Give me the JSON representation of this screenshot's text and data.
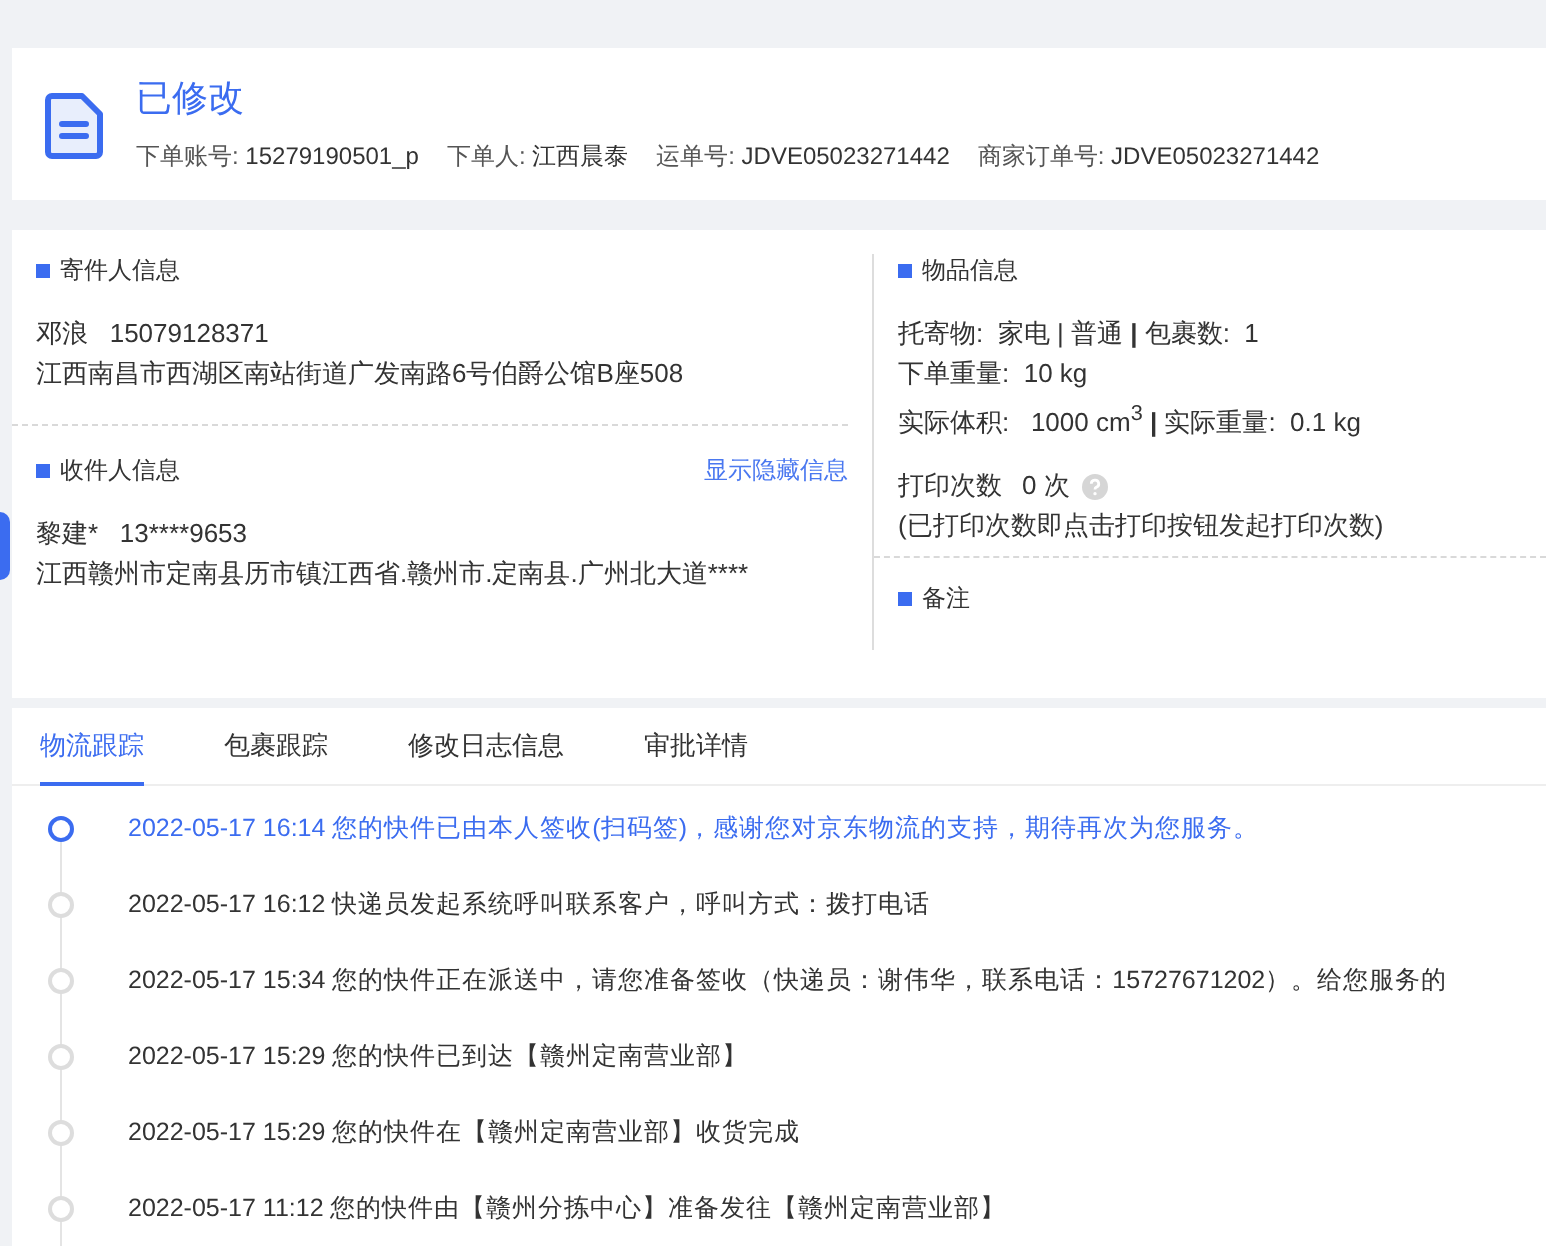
{
  "header": {
    "status": "已修改",
    "fields": [
      {
        "label": "下单账号:",
        "value": "15279190501_p"
      },
      {
        "label": "下单人:",
        "value": "江西晨泰"
      },
      {
        "label": "运单号:",
        "value": "JDVE05023271442"
      },
      {
        "label": "商家订单号:",
        "value": "JDVE05023271442"
      }
    ]
  },
  "sender": {
    "title": "寄件人信息",
    "name": "邓浪",
    "phone": "15079128371",
    "address": "江西南昌市西湖区南站街道广发南路6号伯爵公馆B座508"
  },
  "receiver": {
    "title": "收件人信息",
    "link": "显示隐藏信息",
    "name": "黎建*",
    "phone": "13****9653",
    "address": "江西赣州市定南县历市镇江西省.赣州市.定南县.广州北大道****"
  },
  "goods": {
    "title": "物品信息",
    "lines": [
      "托寄物:  家电 | 普通 **|** 包裹数:  1",
      "下单重量:  10 kg",
      "实际体积:   1000 cm$^{3}$ **|** 实际重量:  0.1 kg"
    ],
    "print_label": "打印次数",
    "print_value": "0 次",
    "print_note": "(已打印次数即点击打印按钮发起打印次数)"
  },
  "remarks": {
    "title": "备注"
  },
  "tabs": [
    {
      "label": "物流跟踪",
      "selected": true
    },
    {
      "label": "包裹跟踪",
      "selected": false
    },
    {
      "label": "修改日志信息",
      "selected": false
    },
    {
      "label": "审批详情",
      "selected": false
    }
  ],
  "timeline": [
    {
      "text": "2022-05-17 16:14 您的快件已由本人签收(扫码签)，感谢您对京东物流的支持，期待再次为您服务。",
      "current": true
    },
    {
      "text": "2022-05-17 16:12 快递员发起系统呼叫联系客户，呼叫方式：拨打电话",
      "current": false
    },
    {
      "text": "2022-05-17 15:34 您的快件正在派送中，请您准备签收（快递员：谢伟华，联系电话：15727671202）。给您服务的",
      "current": false
    },
    {
      "text": "2022-05-17 15:29 您的快件已到达【赣州定南营业部】",
      "current": false
    },
    {
      "text": "2022-05-17 15:29 您的快件在【赣州定南营业部】收货完成",
      "current": false
    },
    {
      "text": "2022-05-17 11:12 您的快件由【赣州分拣中心】准备发往【赣州定南营业部】",
      "current": false
    }
  ]
}
